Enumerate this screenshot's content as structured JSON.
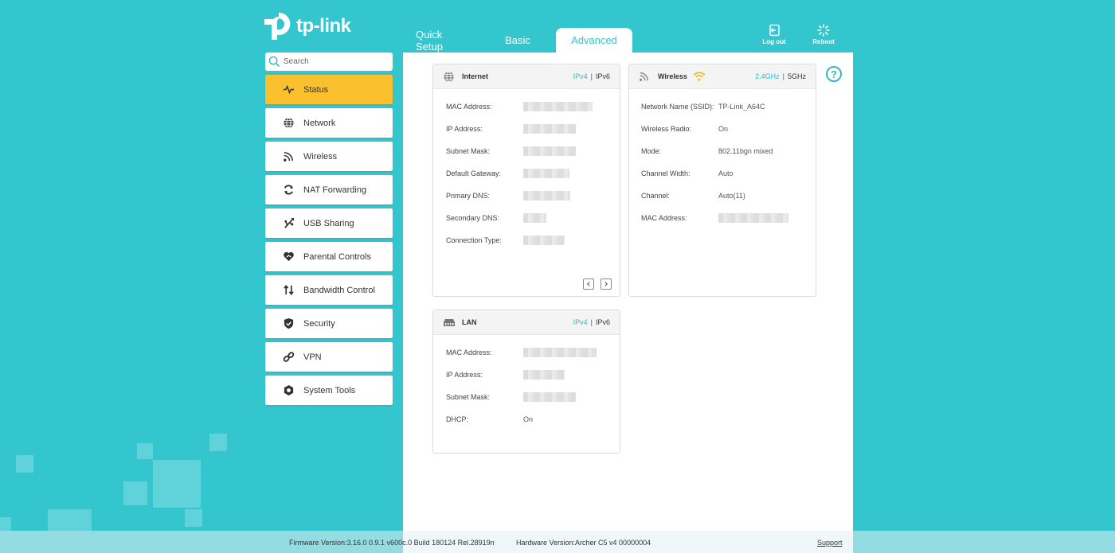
{
  "brand": {
    "logo_text": "tp-link"
  },
  "tabs": [
    {
      "label": "Quick Setup"
    },
    {
      "label": "Basic"
    },
    {
      "label": "Advanced"
    }
  ],
  "top_actions": {
    "logout": "Log out",
    "reboot": "Reboot"
  },
  "search": {
    "placeholder": "Search"
  },
  "sidebar": {
    "items": [
      {
        "label": "Status",
        "icon": "status-pulse-icon"
      },
      {
        "label": "Network",
        "icon": "globe-icon"
      },
      {
        "label": "Wireless",
        "icon": "wifi-icon"
      },
      {
        "label": "NAT Forwarding",
        "icon": "nat-icon"
      },
      {
        "label": "USB Sharing",
        "icon": "usb-icon"
      },
      {
        "label": "Parental Controls",
        "icon": "heart-icon"
      },
      {
        "label": "Bandwidth Control",
        "icon": "updown-arrows-icon"
      },
      {
        "label": "Security",
        "icon": "shield-icon"
      },
      {
        "label": "VPN",
        "icon": "link-icon"
      },
      {
        "label": "System Tools",
        "icon": "gear-icon"
      }
    ]
  },
  "internet": {
    "title": "Internet",
    "ipv4": "IPv4",
    "ipv6": "IPv6",
    "sep": "|",
    "rows": [
      {
        "label": "MAC Address:"
      },
      {
        "label": "IP Address:"
      },
      {
        "label": "Subnet Mask:"
      },
      {
        "label": "Default Gateway:"
      },
      {
        "label": "Primary DNS:"
      },
      {
        "label": "Secondary DNS:"
      },
      {
        "label": "Connection Type:"
      }
    ]
  },
  "wireless": {
    "title": "Wireless",
    "band24": "2.4GHz",
    "band5": "5GHz",
    "sep": "|",
    "rows": [
      {
        "label": "Network Name (SSID):",
        "value": "TP-Link_A64C"
      },
      {
        "label": "Wireless Radio:",
        "value": "On"
      },
      {
        "label": "Mode:",
        "value": "802.11bgn mixed"
      },
      {
        "label": "Channel Width:",
        "value": "Auto"
      },
      {
        "label": "Channel:",
        "value": "Auto(11)"
      },
      {
        "label": "MAC Address:"
      }
    ]
  },
  "lan": {
    "title": "LAN",
    "ipv4": "IPv4",
    "ipv6": "IPv6",
    "sep": "|",
    "rows": [
      {
        "label": "MAC Address:"
      },
      {
        "label": "IP Address:"
      },
      {
        "label": "Subnet Mask:"
      },
      {
        "label": "DHCP:",
        "value": "On"
      }
    ]
  },
  "footer": {
    "firmware": "Firmware Version:3.16.0 0.9.1 v600c.0 Build 180124 Rel.28919n",
    "hardware": "Hardware Version:Archer C5 v4 00000004",
    "support": "Support"
  },
  "colors": {
    "accent": "#34c6cf",
    "active_menu": "#fbc02d",
    "link": "#34b8c8"
  }
}
